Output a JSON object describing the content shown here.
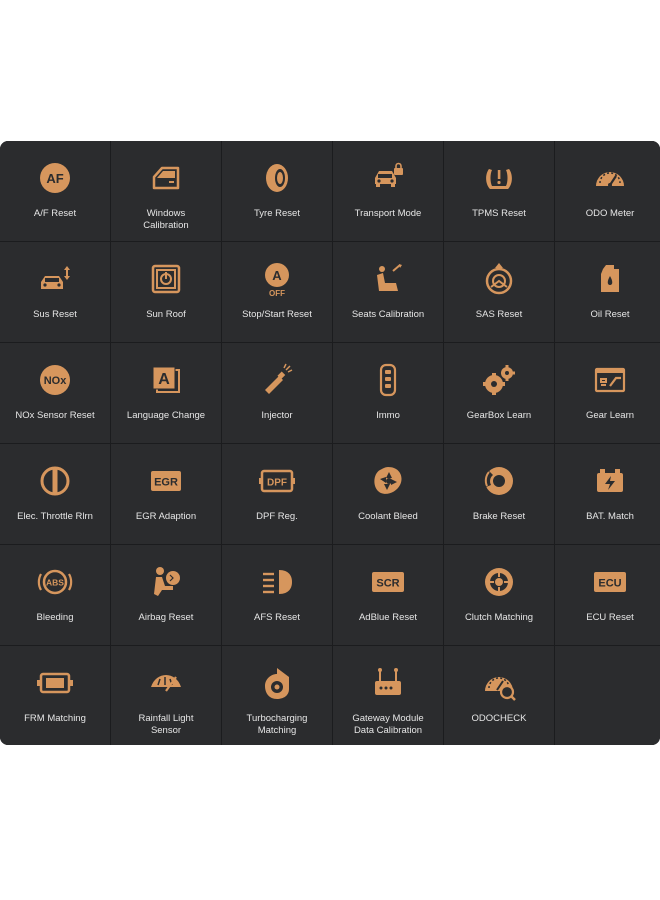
{
  "accent": "#d6965d",
  "items": [
    {
      "label": "A/F Reset",
      "icon": "af-icon",
      "key": "af"
    },
    {
      "label": "Windows\nCalibration",
      "icon": "window-icon",
      "key": "window"
    },
    {
      "label": "Tyre Reset",
      "icon": "tyre-icon",
      "key": "tyre"
    },
    {
      "label": "Transport Mode",
      "icon": "car-lock-icon",
      "key": "transport"
    },
    {
      "label": "TPMS Reset",
      "icon": "tpms-icon",
      "key": "tpms"
    },
    {
      "label": "ODO Meter",
      "icon": "odometer-icon",
      "key": "odo"
    },
    {
      "label": "Sus Reset",
      "icon": "suspension-icon",
      "key": "sus"
    },
    {
      "label": "Sun Roof",
      "icon": "sunroof-icon",
      "key": "sunroof"
    },
    {
      "label": "Stop/Start Reset",
      "icon": "auto-stop-icon",
      "key": "stopstart"
    },
    {
      "label": "Seats Calibration",
      "icon": "seat-icon",
      "key": "seat"
    },
    {
      "label": "SAS Reset",
      "icon": "steering-icon",
      "key": "sas"
    },
    {
      "label": "Oil Reset",
      "icon": "oil-can-icon",
      "key": "oil"
    },
    {
      "label": "NOx Sensor Reset",
      "icon": "nox-icon",
      "key": "nox"
    },
    {
      "label": "Language Change",
      "icon": "language-icon",
      "key": "lang"
    },
    {
      "label": "Injector",
      "icon": "injector-icon",
      "key": "injector"
    },
    {
      "label": "Immo",
      "icon": "key-fob-icon",
      "key": "immo"
    },
    {
      "label": "GearBox Learn",
      "icon": "gears-icon",
      "key": "gearbox"
    },
    {
      "label": "Gear Learn",
      "icon": "gear-learn-icon",
      "key": "gearlearn"
    },
    {
      "label": "Elec. Throttle Rlrn",
      "icon": "throttle-icon",
      "key": "throttle"
    },
    {
      "label": "EGR Adaption",
      "icon": "egr-icon",
      "key": "egr"
    },
    {
      "label": "DPF Reg.",
      "icon": "dpf-icon",
      "key": "dpf"
    },
    {
      "label": "Coolant Bleed",
      "icon": "coolant-fan-icon",
      "key": "coolant"
    },
    {
      "label": "Brake Reset",
      "icon": "brake-disc-icon",
      "key": "brake"
    },
    {
      "label": "BAT. Match",
      "icon": "battery-icon",
      "key": "battery"
    },
    {
      "label": "Bleeding",
      "icon": "abs-icon",
      "key": "abs"
    },
    {
      "label": "Airbag Reset",
      "icon": "airbag-icon",
      "key": "airbag"
    },
    {
      "label": "AFS Reset",
      "icon": "headlight-icon",
      "key": "afs"
    },
    {
      "label": "AdBlue Reset",
      "icon": "scr-icon",
      "key": "scr"
    },
    {
      "label": "Clutch Matching",
      "icon": "clutch-icon",
      "key": "clutch"
    },
    {
      "label": "ECU Reset",
      "icon": "ecu-icon",
      "key": "ecu"
    },
    {
      "label": "FRM Matching",
      "icon": "frm-module-icon",
      "key": "frm"
    },
    {
      "label": "Rainfall Light\nSensor",
      "icon": "wiper-icon",
      "key": "rain"
    },
    {
      "label": "Turbocharging\nMatching",
      "icon": "turbo-icon",
      "key": "turbo"
    },
    {
      "label": "Gateway Module\nData Calibration",
      "icon": "gateway-icon",
      "key": "gateway"
    },
    {
      "label": "ODOCHECK",
      "icon": "odo-check-icon",
      "key": "odocheck"
    }
  ],
  "icon_text": {
    "af": "AF",
    "stopstart_a": "A",
    "stopstart_off": "OFF",
    "nox": "NOx",
    "lang": "A",
    "egr": "EGR",
    "dpf": "DPF",
    "abs": "ABS",
    "scr": "SCR",
    "ecu": "ECU"
  }
}
